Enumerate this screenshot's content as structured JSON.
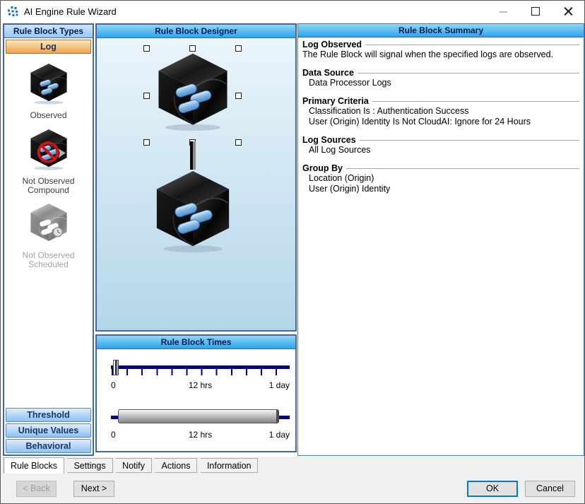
{
  "window": {
    "title": "AI Engine Rule Wizard"
  },
  "titlebar_icons": {
    "app": "logrhythm-dots-icon",
    "minimize": "minimize-icon",
    "maximize": "maximize-icon",
    "close": "close-icon"
  },
  "left_panel": {
    "header": "Rule Block Types",
    "log_tab": "Log",
    "items": [
      {
        "label": "Observed"
      },
      {
        "label": "Not Observed Compound"
      },
      {
        "label": "Not Observed Scheduled"
      }
    ],
    "bottom_buttons": [
      {
        "label": "Threshold"
      },
      {
        "label": "Unique Values"
      },
      {
        "label": "Behavioral"
      }
    ]
  },
  "designer": {
    "header": "Rule Block Designer"
  },
  "times": {
    "header": "Rule Block Times",
    "slider1_labels": [
      "0",
      "12 hrs",
      "1 day"
    ],
    "slider2_labels": [
      "0",
      "12 hrs",
      "1 day"
    ]
  },
  "summary": {
    "header": "Rule Block Summary",
    "sections": [
      {
        "title": "Log Observed",
        "lines": [
          "The Rule Block will signal when the specified logs are observed."
        ]
      },
      {
        "title": "Data Source",
        "lines": [
          "Data Processor Logs"
        ]
      },
      {
        "title": "Primary Criteria",
        "lines": [
          "Classification Is : Authentication Success",
          "User (Origin) Identity Is Not CloudAI: Ignore for 24 Hours"
        ]
      },
      {
        "title": "Log Sources",
        "lines": [
          "All Log Sources"
        ]
      },
      {
        "title": "Group By",
        "lines": [
          "Location (Origin)",
          "User (Origin) Identity"
        ]
      }
    ]
  },
  "tabs": [
    {
      "label": "Rule Blocks",
      "active": true
    },
    {
      "label": "Settings",
      "active": false
    },
    {
      "label": "Notify",
      "active": false
    },
    {
      "label": "Actions",
      "active": false
    },
    {
      "label": "Information",
      "active": false
    }
  ],
  "footer": {
    "back": "< Back",
    "next": "Next >",
    "ok": "OK",
    "cancel": "Cancel"
  },
  "colors": {
    "header_gradient_top": "#8ed8f8",
    "header_gradient_bottom": "#2ea4ec",
    "panel_border": "#4166ad",
    "slider_navy": "#00008b",
    "log_tab_orange": "#f1a34c",
    "focus_blue": "#0078d7",
    "pill_blue": "#5b9bd5"
  }
}
